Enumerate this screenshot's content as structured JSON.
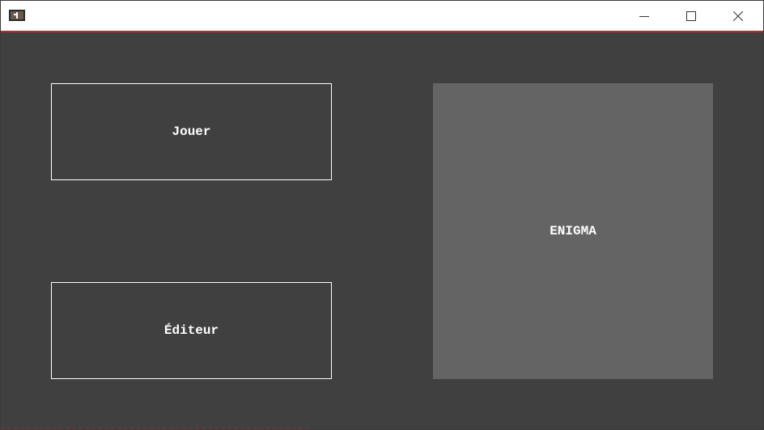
{
  "window": {
    "controls": {
      "minimize_icon": "minimize-icon",
      "maximize_icon": "maximize-icon",
      "close_icon": "close-icon"
    },
    "accent_color": "#c0292b"
  },
  "menu": {
    "play_label": "Jouer",
    "editor_label": "Éditeur"
  },
  "logo": {
    "text": "ENIGMA",
    "panel_color": "#646464"
  },
  "colors": {
    "background": "#404040",
    "button_border": "#ffffff",
    "text": "#ffffff"
  }
}
